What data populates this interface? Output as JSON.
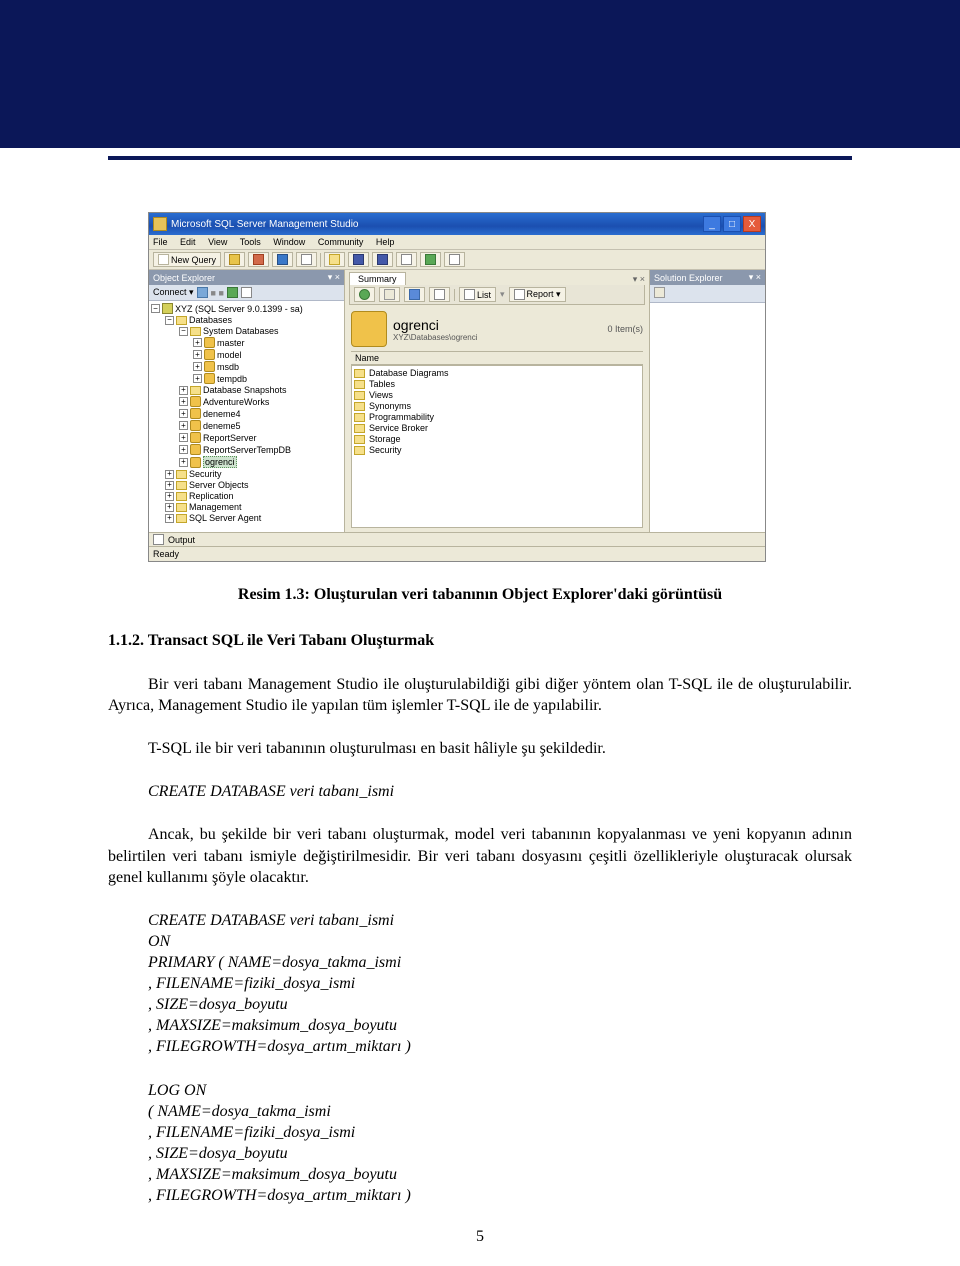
{
  "header": {},
  "screenshot": {
    "title": "Microsoft SQL Server Management Studio",
    "window_controls": {
      "min": "_",
      "max": "□",
      "close": "X"
    },
    "menu": [
      "File",
      "Edit",
      "View",
      "Tools",
      "Window",
      "Community",
      "Help"
    ],
    "toolbar": {
      "new_query": "New Query"
    },
    "object_explorer": {
      "title": "Object Explorer",
      "connect_label": "Connect ▾",
      "root": "XYZ (SQL Server 9.0.1399 - sa)",
      "databases_label": "Databases",
      "system_db_label": "System Databases",
      "system_dbs": [
        "master",
        "model",
        "msdb",
        "tempdb"
      ],
      "snapshots_label": "Database Snapshots",
      "user_dbs": [
        "AdventureWorks",
        "deneme4",
        "deneme5",
        "ReportServer",
        "ReportServerTempDB"
      ],
      "selected_db": "ogrenci",
      "server_nodes": [
        "Security",
        "Server Objects",
        "Replication",
        "Management",
        "SQL Server Agent"
      ]
    },
    "summary": {
      "tab": "Summary",
      "list_btn": "List",
      "report_btn": "Report ▾",
      "db_name": "ogrenci",
      "breadcrumb": "XYZ\\Databases\\ogrenci",
      "item_count": "0 Item(s)",
      "name_header": "Name",
      "items": [
        "Database Diagrams",
        "Tables",
        "Views",
        "Synonyms",
        "Programmability",
        "Service Broker",
        "Storage",
        "Security"
      ]
    },
    "solution_explorer": {
      "title": "Solution Explorer",
      "pin": "▾ ×"
    },
    "output_label": "Output",
    "status": "Ready"
  },
  "doc": {
    "caption": "Resim 1.3: Oluşturulan veri tabanının Object Explorer'daki görüntüsü",
    "subhead": "1.1.2. Transact SQL ile Veri Tabanı Oluşturmak",
    "p1": "Bir veri tabanı Management Studio ile oluşturulabildiği gibi diğer yöntem olan T-SQL ile de oluşturulabilir. Ayrıca, Management Studio ile yapılan tüm işlemler T-SQL ile de yapılabilir.",
    "p2": "T-SQL ile bir veri tabanının oluşturulması en basit hâliyle şu şekildedir.",
    "code1": "CREATE DATABASE veri tabanı_ismi",
    "p3": "Ancak, bu şekilde bir veri tabanı oluşturmak, model veri tabanının kopyalanması ve yeni kopyanın adının belirtilen veri tabanı ismiyle değiştirilmesidir. Bir veri tabanı dosyasını çeşitli özellikleriyle oluşturacak olursak genel kullanımı şöyle olacaktır.",
    "block1": [
      "CREATE DATABASE veri tabanı_ismi",
      "ON",
      "PRIMARY ( NAME=dosya_takma_ismi",
      ", FILENAME=fiziki_dosya_ismi",
      ", SIZE=dosya_boyutu",
      ", MAXSIZE=maksimum_dosya_boyutu",
      ", FILEGROWTH=dosya_artım_miktarı )"
    ],
    "block2": [
      "LOG ON",
      "( NAME=dosya_takma_ismi",
      ", FILENAME=fiziki_dosya_ismi",
      ", SIZE=dosya_boyutu",
      ", MAXSIZE=maksimum_dosya_boyutu",
      ", FILEGROWTH=dosya_artım_miktarı )"
    ],
    "page": "5"
  }
}
